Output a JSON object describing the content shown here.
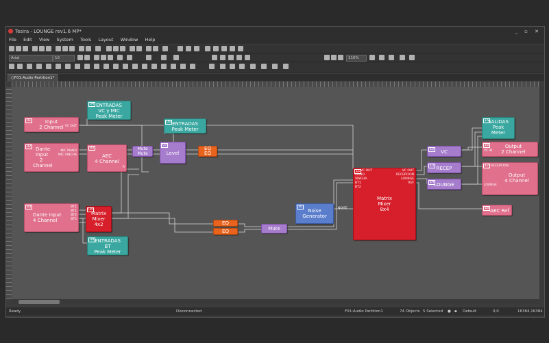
{
  "window": {
    "title": "Tesira - LOUNGE rev1.6 MP*",
    "controls": "_ ▫ ✕"
  },
  "menu": [
    "File",
    "Edit",
    "View",
    "System",
    "Tools",
    "Layout",
    "Window",
    "Help"
  ],
  "toolbar": {
    "font": "Arial",
    "size": "10",
    "zoom": "110%"
  },
  "tab": "○F01:Audio Partition1*",
  "blocks": {
    "input2": {
      "l1": "Input",
      "l2": "2 Channel",
      "port": "VC OUT"
    },
    "dante2": {
      "l1": "Dante",
      "l2": "Input",
      "l3": "2",
      "l4": "Channel",
      "p1": "MIC MANO",
      "p2": "MIC VINCHA"
    },
    "dante4": {
      "l1": "Dante Input",
      "l2": "4 Channel",
      "p1": "BT1",
      "p2": "BT1",
      "p3": "BT2",
      "p4": "BT2"
    },
    "pm_vc": {
      "l1": "ENTRADAS",
      "l2": "VC y MIC",
      "l3": "Peak Meter"
    },
    "pm_ent": {
      "l1": "ENTRADAS",
      "l2": "Peak Meter"
    },
    "aec": {
      "l1": "AEC",
      "l2": "4 Channel",
      "port": "R"
    },
    "mute1": {
      "l1": "Mute",
      "l2": "Mute"
    },
    "level": {
      "l1": "Level"
    },
    "eq_a": {
      "l1": "EQ",
      "l2": "EQ"
    },
    "mm42": {
      "l1": "Matrix",
      "l2": "Mixer",
      "l3": "4x2"
    },
    "pm_bt": {
      "l1": "ENTRADAS",
      "l2": "BT",
      "l3": "Peak Meter"
    },
    "eq_b": {
      "l1": "EQ",
      "l2": "EQ"
    },
    "mute2": {
      "l1": "Mute"
    },
    "noise": {
      "l1": "Noise",
      "l2": "Generator",
      "port": "NOISE"
    },
    "mm84": {
      "l1": "Matrix",
      "l2": "Mixer",
      "l3": "8x4",
      "in1": "VC OUT",
      "in2": "MANO",
      "in3": "VINCHA",
      "in4": "BT1",
      "in5": "BT2",
      "out1": "VC OUT",
      "out2": "RECEPCION",
      "out3": "LOUNGE",
      "out4": "REF"
    },
    "vc": {
      "l1": "VC"
    },
    "recep": {
      "l1": "RECEP"
    },
    "lounge": {
      "l1": "LOUNGE"
    },
    "pm_sal": {
      "l1": "SALIDAS",
      "l2": "Peak",
      "l3": "Meter"
    },
    "out2": {
      "l1": "Output",
      "l2": "2 Channel",
      "port": "VC IN"
    },
    "out4": {
      "l1": "Output",
      "l2": "4 Channel",
      "p1": "RECEPCION",
      "p2": "LOUNGE"
    },
    "aecref": {
      "l1": "AEC Ref"
    }
  },
  "status": {
    "ready": "Ready",
    "conn": "Disconnected",
    "partition": "F01:Audio Partition1",
    "objects": "74 Objects",
    "selected": "5 Selected",
    "layer": "Default",
    "coords": "0,0",
    "size": "16384,16384"
  },
  "colors": {
    "pink": "#e0708c",
    "teal": "#3aa8a0",
    "purple": "#a67ccc",
    "orange": "#e8641e",
    "red": "#d71f2b",
    "blue": "#5a7ecc"
  }
}
